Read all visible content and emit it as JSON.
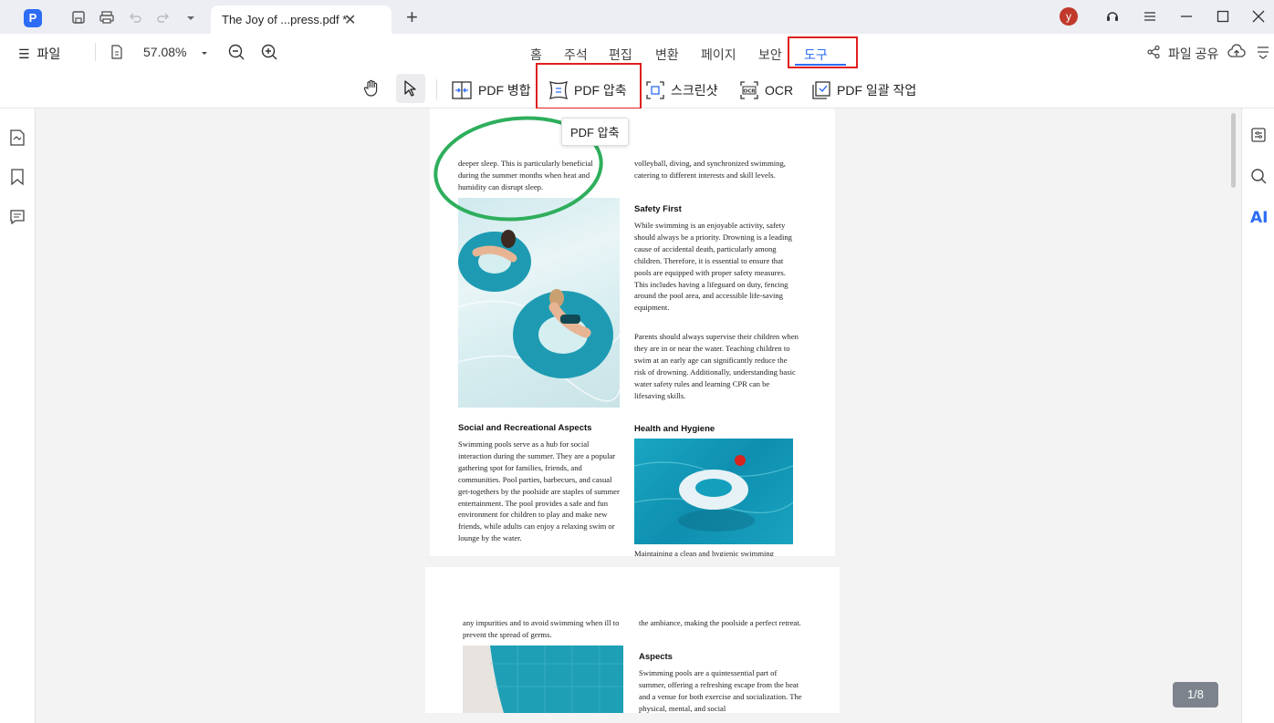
{
  "titlebar": {
    "tab_title": "The Joy of ...press.pdf *",
    "avatar_initial": "y"
  },
  "menubar": {
    "file_label": "파일",
    "zoom_value": "57.08%",
    "nav_tabs": [
      "홈",
      "주석",
      "편집",
      "변환",
      "페이지",
      "보안",
      "도구"
    ],
    "share_label": "파일 공유"
  },
  "toolbar": {
    "tools": [
      {
        "label": "PDF 병합",
        "icon": "merge-icon"
      },
      {
        "label": "PDF 압축",
        "icon": "compress-icon"
      },
      {
        "label": "스크린샷",
        "icon": "screenshot-icon"
      },
      {
        "label": "OCR",
        "icon": "ocr-icon"
      },
      {
        "label": "PDF 일괄 작업",
        "icon": "batch-icon"
      }
    ],
    "tooltip": "PDF 압축"
  },
  "page1": {
    "left_intro": "deeper sleep. This is particularly beneficial during the summer months when heat and humidity can disrupt sleep.",
    "right_intro": "volleyball, diving, and synchronized swimming, catering to different interests and skill levels.",
    "safety_heading": "Safety First",
    "safety_p1": "While swimming is an enjoyable activity, safety should always be a priority. Drowning is a leading cause of accidental death, particularly among children. Therefore, it is essential to ensure that pools are equipped with proper safety measures. This includes having a lifeguard on duty, fencing around the pool area, and accessible life-saving equipment.",
    "safety_p2": "Parents should always supervise their children when they are in or near the water. Teaching children to swim at an early age can significantly reduce the risk of drowning. Additionally, understanding basic water safety rules and learning CPR can be lifesaving skills.",
    "social_heading": "Social and Recreational Aspects",
    "social_p": "Swimming pools serve as a hub for social interaction during the summer. They are a popular gathering spot for families, friends, and communities. Pool parties, barbecues, and casual get-togethers by the poolside are staples of summer entertainment. The pool provides a safe and fun environment for children to play and make new friends, while adults can enjoy a relaxing swim or lounge by the water.",
    "health_heading": "Health and Hygiene",
    "health_p": "Maintaining a clean and hygienic swimming"
  },
  "page2": {
    "left_text": "any impurities and to avoid swimming when ill to prevent the spread of germs.",
    "right_text": "the ambiance, making the poolside a perfect retreat.",
    "aspects_heading": "Aspects",
    "aspects_p": "Swimming pools are a quintessential part of summer, offering a refreshing escape from the heat and a venue for both exercise and socialization. The physical, mental, and social"
  },
  "page_indicator": "1/8",
  "colors": {
    "accent": "#2d6cf5",
    "highlight_box": "#e01e1e",
    "annotation_circle": "#2eae5c"
  }
}
